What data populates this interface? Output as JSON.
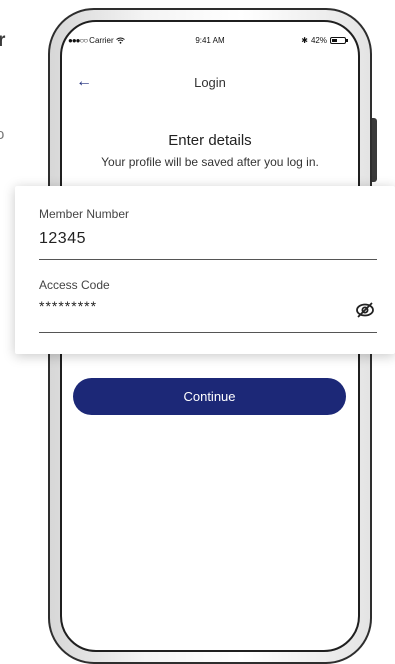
{
  "background": {
    "fragment_top": "r",
    "fragment_mid": "o"
  },
  "status_bar": {
    "carrier": "Carrier",
    "time": "9:41 AM",
    "battery": "42%"
  },
  "nav": {
    "title": "Login",
    "back_icon": "arrow-left-icon"
  },
  "heading": "Enter details",
  "subheading": "Your profile will be saved after you log in.",
  "form": {
    "member_number_label": "Member Number",
    "member_number_value": "12345",
    "access_code_label": "Access Code",
    "access_code_value": "*********",
    "visibility_icon": "eye-off-icon"
  },
  "continue_label": "Continue",
  "colors": {
    "accent": "#1c2877",
    "text": "#222222"
  }
}
